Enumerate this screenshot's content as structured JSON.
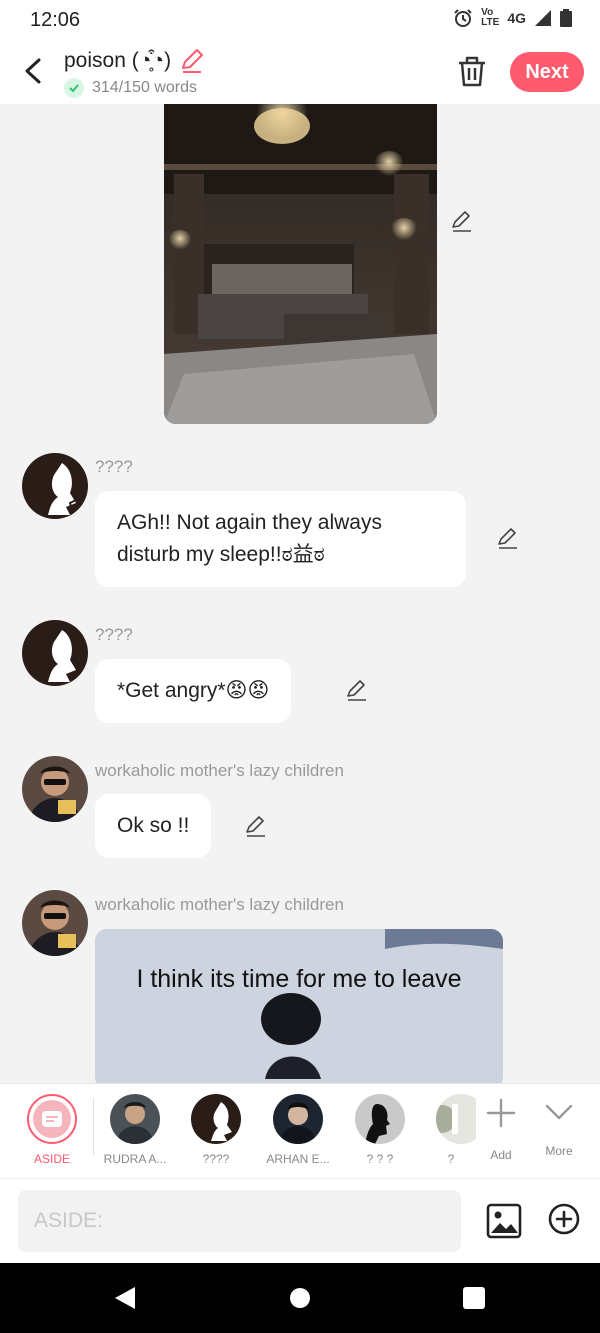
{
  "status": {
    "time": "12:06",
    "network_top": "Vo",
    "network_bottom": "LTE",
    "network_type": "4G"
  },
  "header": {
    "title": "poison (◔̥͒◔)",
    "word_count": "314/150 words",
    "next_label": "Next"
  },
  "messages": [
    {
      "name": "????",
      "text": "AGh!! Not again they always disturb my sleep!!ಠ益ಠ"
    },
    {
      "name": "????",
      "text": "*Get angry*😡😡"
    },
    {
      "name": "workaholic mother's lazy children",
      "text": "Ok so !!"
    },
    {
      "name": "workaholic mother's lazy children",
      "meme_caption": "I think its time for me to leave"
    }
  ],
  "characters": [
    {
      "label": "ASIDE"
    },
    {
      "label": "RUDRA A..."
    },
    {
      "label": "????"
    },
    {
      "label": "ARHAN E..."
    },
    {
      "label": "? ? ?"
    },
    {
      "label": "?"
    },
    {
      "label": "Add"
    },
    {
      "label": "More"
    }
  ],
  "input": {
    "placeholder": "ASIDE:"
  },
  "colors": {
    "accent": "#ff5a6e",
    "check_bg": "#d9f5e3",
    "check": "#2ec46c"
  }
}
